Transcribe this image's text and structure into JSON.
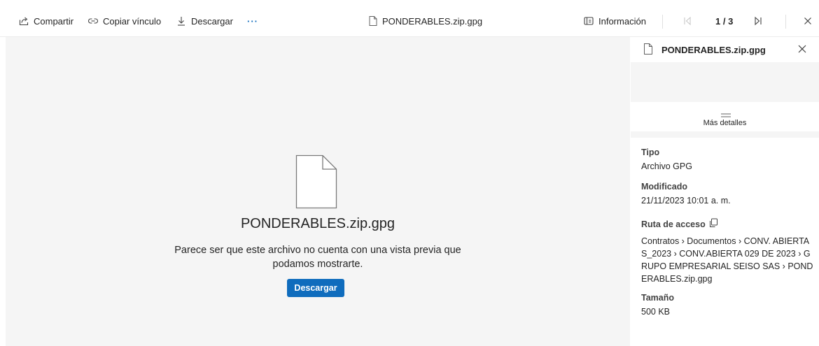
{
  "toolbar": {
    "share_label": "Compartir",
    "copy_link_label": "Copiar vínculo",
    "download_label": "Descargar",
    "more_label": "···",
    "file_title": "PONDERABLES.zip.gpg",
    "info_label": "Información",
    "page_indicator": "1 / 3"
  },
  "viewer": {
    "filename": "PONDERABLES.zip.gpg",
    "message": "Parece ser que este archivo no cuenta con una vista previa que podamos mostrarte.",
    "download_button": "Descargar"
  },
  "details_panel": {
    "title": "PONDERABLES.zip.gpg",
    "more_details_label": "Más detalles",
    "type_label": "Tipo",
    "type_value": "Archivo GPG",
    "modified_label": "Modificado",
    "modified_value": "21/11/2023 10:01 a. m.",
    "path_label": "Ruta de acceso",
    "path_value": "Contratos › Documentos › CONV. ABIERTAS_2023 › CONV.ABIERTA 029 DE 2023 › GRUPO EMPRESARIAL SEISO SAS › PONDERABLES.zip.gpg",
    "size_label": "Tamaño",
    "size_value": "500 KB"
  },
  "colors": {
    "primary_button": "#0f6cbd",
    "viewer_background": "#f5f5f5"
  },
  "icons": [
    "share-icon",
    "link-icon",
    "download-icon",
    "more-icon",
    "file-icon",
    "info-panel-icon",
    "first-page-icon",
    "last-page-icon",
    "close-icon",
    "drag-lines-icon",
    "copy-icon"
  ]
}
